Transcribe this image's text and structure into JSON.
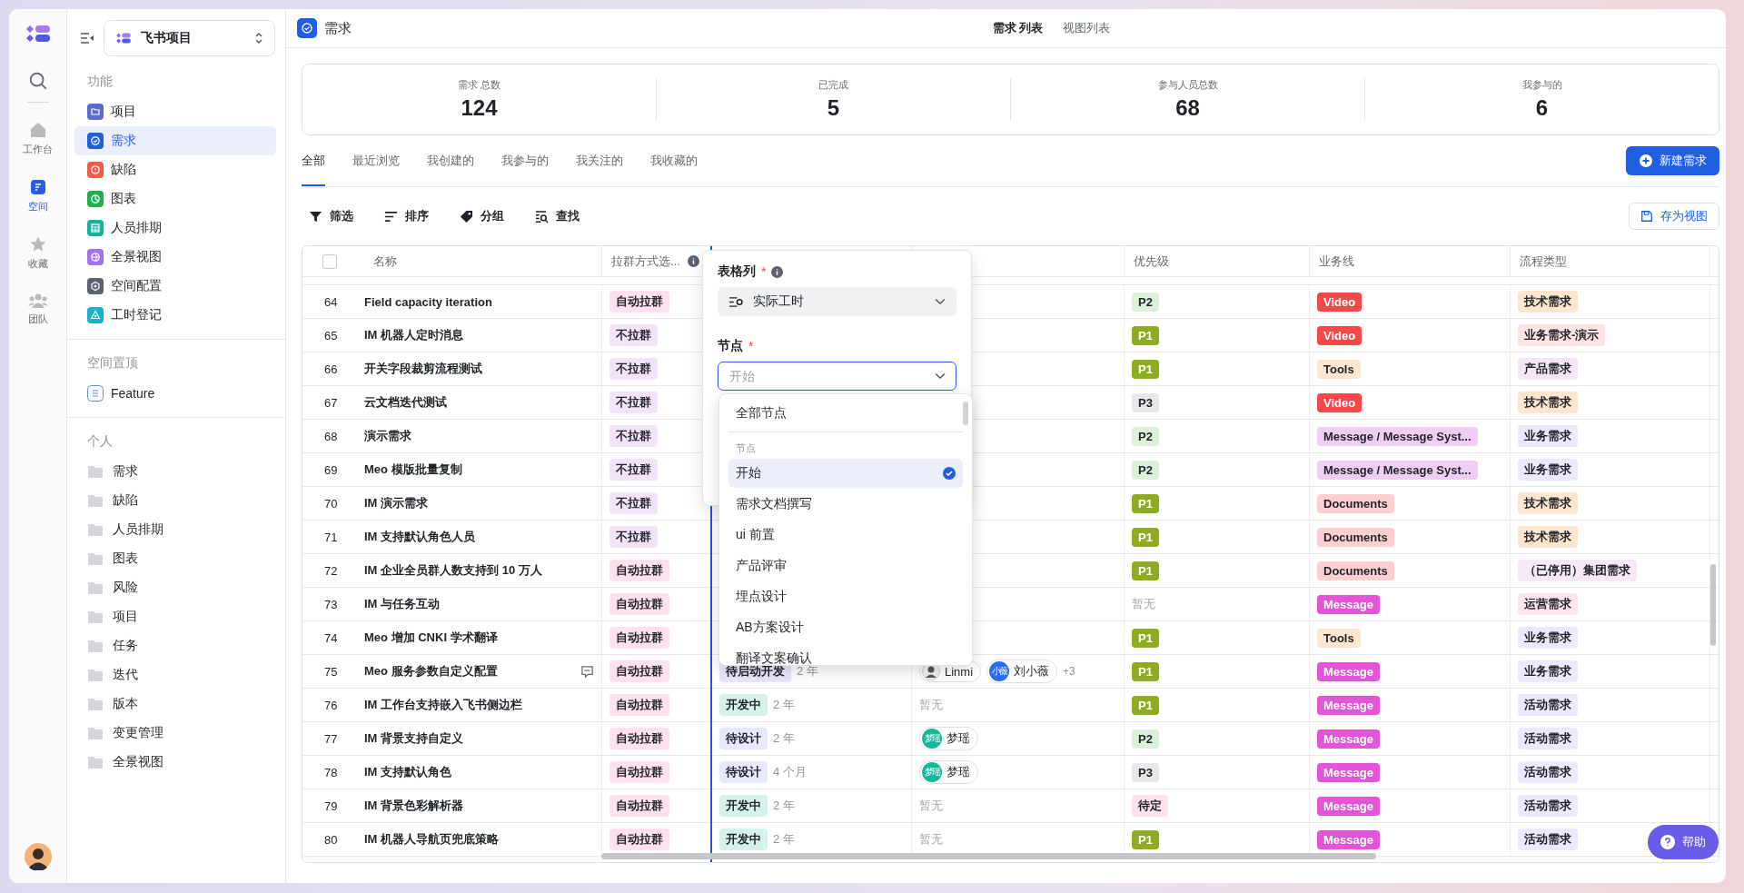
{
  "rail": {
    "items": [
      {
        "label": "工作台",
        "selected": false
      },
      {
        "label": "空间",
        "selected": true
      },
      {
        "label": "收藏",
        "selected": false
      },
      {
        "label": "团队",
        "selected": false
      }
    ]
  },
  "sidebar": {
    "project_select": "飞书项目",
    "sections": [
      {
        "title": "功能",
        "kind": "feature",
        "items": [
          {
            "label": "项目",
            "color": "#5b6bd0",
            "selected": false
          },
          {
            "label": "需求",
            "color": "#1f5fe0",
            "selected": true
          },
          {
            "label": "缺陷",
            "color": "#f5594a",
            "selected": false
          },
          {
            "label": "图表",
            "color": "#21b04b",
            "selected": false
          },
          {
            "label": "人员排期",
            "color": "#14b39a",
            "selected": false
          },
          {
            "label": "全景视图",
            "color": "#a371f0",
            "selected": false
          },
          {
            "label": "空间配置",
            "color": "#5c6270",
            "selected": false
          },
          {
            "label": "工时登记",
            "color": "#14b3c9",
            "selected": false
          }
        ]
      },
      {
        "title": "空间置顶",
        "kind": "pinned",
        "items": [
          {
            "label": "Feature",
            "selected": false
          }
        ]
      },
      {
        "title": "个人",
        "kind": "folder",
        "items": [
          {
            "label": "需求",
            "selected": false
          },
          {
            "label": "缺陷",
            "selected": false
          },
          {
            "label": "人员排期",
            "selected": false
          },
          {
            "label": "图表",
            "selected": false
          },
          {
            "label": "风险",
            "selected": false
          },
          {
            "label": "项目",
            "selected": false
          },
          {
            "label": "任务",
            "selected": false
          },
          {
            "label": "迭代",
            "selected": false
          },
          {
            "label": "版本",
            "selected": false
          },
          {
            "label": "变更管理",
            "selected": false
          },
          {
            "label": "全景视图",
            "selected": false
          }
        ]
      }
    ]
  },
  "header": {
    "title": "需求",
    "tabs": [
      {
        "label": "需求 列表",
        "selected": true
      },
      {
        "label": "视图列表",
        "selected": false
      }
    ]
  },
  "stats": [
    {
      "label": "需求 总数",
      "value": "124"
    },
    {
      "label": "已完成",
      "value": "5"
    },
    {
      "label": "参与人员总数",
      "value": "68"
    },
    {
      "label": "我参与的",
      "value": "6"
    }
  ],
  "view_tabs": [
    {
      "label": "全部",
      "selected": true
    },
    {
      "label": "最近浏览",
      "selected": false
    },
    {
      "label": "我创建的",
      "selected": false
    },
    {
      "label": "我参与的",
      "selected": false
    },
    {
      "label": "我关注的",
      "selected": false
    },
    {
      "label": "我收藏的",
      "selected": false
    }
  ],
  "new_button": "新建需求",
  "toolbar": [
    {
      "label": "筛选",
      "kind": "filter"
    },
    {
      "label": "排序",
      "kind": "sort"
    },
    {
      "label": "分组",
      "kind": "group"
    },
    {
      "label": "查找",
      "kind": "find"
    }
  ],
  "save_view_button": "存为视图",
  "table": {
    "select_all_checked": false,
    "columns": [
      "名称",
      "拉群方式选...",
      "",
      "",
      "优先级",
      "业务线",
      "流程类型"
    ],
    "rows": [
      {
        "num": "64",
        "name": "Field capacity iteration",
        "group": {
          "text": "自动拉群",
          "color": "#fde2ee"
        },
        "priority": {
          "text": "P2",
          "color": "#dcf2d8"
        },
        "business": {
          "text": "Video",
          "color": "#f5484a"
        },
        "flow": {
          "text": "技术需求",
          "color": "#fde6cf"
        }
      },
      {
        "num": "65",
        "name": "IM 机器人定时消息",
        "group": {
          "text": "不拉群",
          "color": "#f3e3f8"
        },
        "priority": {
          "text": "P1",
          "color": "#8eac1f"
        },
        "business": {
          "text": "Video",
          "color": "#f5484a"
        },
        "flow": {
          "text": "业务需求-演示",
          "color": "#fde3e3"
        }
      },
      {
        "num": "66",
        "name": "开关字段裁剪流程测试",
        "group": {
          "text": "不拉群",
          "color": "#f3e3f8"
        },
        "priority": {
          "text": "P1",
          "color": "#8eac1f"
        },
        "business": {
          "text": "Tools",
          "color": "#fde6cf"
        },
        "flow": {
          "text": "产品需求",
          "color": "#f6e5f6"
        }
      },
      {
        "num": "67",
        "name": "云文档迭代测试",
        "group": {
          "text": "不拉群",
          "color": "#f3e3f8"
        },
        "priority": {
          "text": "P3",
          "color": "#e8e8ea"
        },
        "business": {
          "text": "Video",
          "color": "#f5484a"
        },
        "flow": {
          "text": "技术需求",
          "color": "#fde6cf"
        }
      },
      {
        "num": "68",
        "name": "演示需求",
        "group": {
          "text": "不拉群",
          "color": "#f3e3f8"
        },
        "priority": {
          "text": "P2",
          "color": "#dcf2d8"
        },
        "business": {
          "text": "Message / Message Syst...",
          "color": "#f0cdf3"
        },
        "flow": {
          "text": "业务需求",
          "color": "#ede8fb"
        }
      },
      {
        "num": "69",
        "name": "Meo 模版批量复制",
        "group": {
          "text": "不拉群",
          "color": "#f3e3f8"
        },
        "priority": {
          "text": "P2",
          "color": "#dcf2d8"
        },
        "business": {
          "text": "Message / Message Syst...",
          "color": "#f0cdf3"
        },
        "flow": {
          "text": "业务需求",
          "color": "#ede8fb"
        }
      },
      {
        "num": "70",
        "name": "IM 演示需求",
        "group": {
          "text": "不拉群",
          "color": "#f3e3f8"
        },
        "priority": {
          "text": "P1",
          "color": "#8eac1f"
        },
        "business": {
          "text": "Documents",
          "color": "#fdcfd0"
        },
        "flow": {
          "text": "技术需求",
          "color": "#fde6cf"
        }
      },
      {
        "num": "71",
        "name": "IM 支持默认角色人员",
        "group": {
          "text": "不拉群",
          "color": "#f3e3f8"
        },
        "priority": {
          "text": "P1",
          "color": "#8eac1f"
        },
        "business": {
          "text": "Documents",
          "color": "#fdcfd0"
        },
        "flow": {
          "text": "技术需求",
          "color": "#fde6cf"
        }
      },
      {
        "num": "72",
        "name": "IM 企业全员群人数支持到 10 万人",
        "group": {
          "text": "自动拉群",
          "color": "#fde2ee"
        },
        "priority": {
          "text": "P1",
          "color": "#8eac1f"
        },
        "business": {
          "text": "Documents",
          "color": "#fdcfd0"
        },
        "flow": {
          "text": "（已停用）集团需求",
          "color": "#f6e8f7"
        }
      },
      {
        "num": "73",
        "name": "IM 与任务互动",
        "group": {
          "text": "自动拉群",
          "color": "#fde2ee"
        },
        "priority": {
          "text": "暂无"
        },
        "business": {
          "text": "Message",
          "color": "#e354d9"
        },
        "flow": {
          "text": "运营需求",
          "color": "#fde4ee"
        }
      },
      {
        "num": "74",
        "name": "Meo 增加 CNKI 学术翻译",
        "group": {
          "text": "自动拉群",
          "color": "#fde2ee"
        },
        "priority": {
          "text": "P1",
          "color": "#8eac1f"
        },
        "business": {
          "text": "Tools",
          "color": "#fde6cf"
        },
        "flow": {
          "text": "业务需求",
          "color": "#ede8fb"
        }
      },
      {
        "num": "75",
        "name": "Meo 服务参数自定义配置",
        "comment": true,
        "group": {
          "text": "自动拉群",
          "color": "#fde2ee"
        },
        "status": {
          "text": "待启动开发",
          "color": "#ece6fb"
        },
        "age": "2 年",
        "people": [
          {
            "name": "Linmi",
            "kind": "figure"
          },
          {
            "name": "刘小薇",
            "kind": "text",
            "avatar_text": "小薇",
            "color": "#2a6cf0"
          }
        ],
        "more": "+3",
        "priority": {
          "text": "P1",
          "color": "#8eac1f"
        },
        "business": {
          "text": "Message",
          "color": "#e354d9"
        },
        "flow": {
          "text": "业务需求",
          "color": "#ede8fb"
        }
      },
      {
        "num": "76",
        "name": "IM 工作台支持嵌入飞书侧边栏",
        "group": {
          "text": "自动拉群",
          "color": "#fde2ee"
        },
        "status": {
          "text": "开发中",
          "color": "#d5f1ea"
        },
        "age": "2 年",
        "empty": "暂无",
        "priority": {
          "text": "P1",
          "color": "#8eac1f"
        },
        "business": {
          "text": "Message",
          "color": "#e354d9"
        },
        "flow": {
          "text": "活动需求",
          "color": "#ede8fb"
        }
      },
      {
        "num": "77",
        "name": "IM 背景支持自定义",
        "group": {
          "text": "自动拉群",
          "color": "#fde2ee"
        },
        "status": {
          "text": "待设计",
          "color": "#e6e9fb"
        },
        "age": "2 年",
        "people": [
          {
            "name": "梦瑶",
            "kind": "text",
            "avatar_text": "梦瑶",
            "color": "#14b89a"
          }
        ],
        "priority": {
          "text": "P2",
          "color": "#dcf2d8"
        },
        "business": {
          "text": "Message",
          "color": "#e354d9"
        },
        "flow": {
          "text": "活动需求",
          "color": "#ede8fb"
        }
      },
      {
        "num": "78",
        "name": "IM 支持默认角色",
        "group": {
          "text": "自动拉群",
          "color": "#fde2ee"
        },
        "status": {
          "text": "待设计",
          "color": "#e6e9fb"
        },
        "age": "4 个月",
        "people": [
          {
            "name": "梦瑶",
            "kind": "text",
            "avatar_text": "梦瑶",
            "color": "#14b89a"
          }
        ],
        "priority": {
          "text": "P3",
          "color": "#e8e8ea"
        },
        "business": {
          "text": "Message",
          "color": "#e354d9"
        },
        "flow": {
          "text": "活动需求",
          "color": "#ede8fb"
        }
      },
      {
        "num": "79",
        "name": "IM 背景色彩解析器",
        "group": {
          "text": "自动拉群",
          "color": "#fde2ee"
        },
        "status": {
          "text": "开发中",
          "color": "#d5f1ea"
        },
        "age": "2 年",
        "empty": "暂无",
        "priority": {
          "text": "待定",
          "color": "#fde3ec"
        },
        "business": {
          "text": "Message",
          "color": "#e354d9"
        },
        "flow": {
          "text": "活动需求",
          "color": "#ede8fb"
        }
      },
      {
        "num": "80",
        "name": "IM 机器人导航页兜底策略",
        "group": {
          "text": "自动拉群",
          "color": "#fde2ee"
        },
        "status": {
          "text": "开发中",
          "color": "#d5f1ea"
        },
        "age": "2 年",
        "empty": "暂无",
        "priority": {
          "text": "P1",
          "color": "#8eac1f"
        },
        "business": {
          "text": "Message",
          "color": "#e354d9"
        },
        "flow": {
          "text": "活动需求",
          "color": "#ede8fb"
        }
      }
    ]
  },
  "popover": {
    "column_field": {
      "label": "表格列",
      "required_mark": "*",
      "info": true,
      "value": "实际工时"
    },
    "node_field": {
      "label": "节点",
      "required_mark": "*",
      "placeholder": "开始",
      "focused": true
    },
    "dropdown": {
      "all_option": "全部节点",
      "group_label": "节点",
      "options": [
        {
          "label": "开始",
          "selected": true
        },
        {
          "label": "需求文档撰写",
          "selected": false
        },
        {
          "label": "ui 前置",
          "selected": false
        },
        {
          "label": "产品评审",
          "selected": false
        },
        {
          "label": "埋点设计",
          "selected": false
        },
        {
          "label": "AB方案设计",
          "selected": false
        },
        {
          "label": "翻译文案确认",
          "selected": false
        }
      ]
    }
  },
  "help_button": "帮助"
}
